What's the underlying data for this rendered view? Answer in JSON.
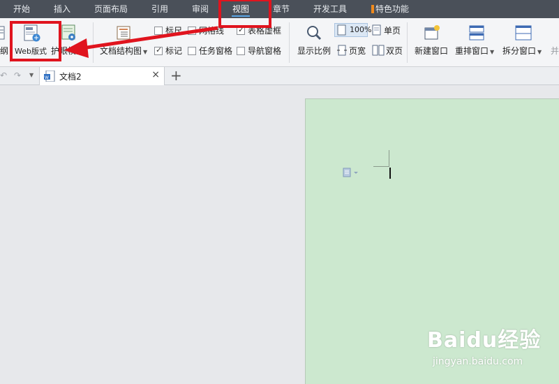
{
  "menubar": {
    "items": [
      "开始",
      "插入",
      "页面布局",
      "引用",
      "审阅",
      "视图",
      "章节",
      "开发工具",
      "特色功能"
    ],
    "active": "视图"
  },
  "ribbon": {
    "outline_label": "纲",
    "web_layout_label": "Web版式",
    "protect_mode_label": "护眼模式",
    "doc_structure_label": "文档结构图",
    "ruler_label": "标尺",
    "gridlines_label": "网格线",
    "table_frame_label": "表格虚框",
    "mark_label": "标记",
    "task_pane_label": "任务窗格",
    "nav_pane_label": "导航窗格",
    "zoom_label": "显示比例",
    "zoom_100_label": "100%",
    "single_page_label": "单页",
    "page_width_label": "页宽",
    "double_page_label": "双页",
    "new_window_label": "新建窗口",
    "arrange_window_label": "重排窗口",
    "split_window_label": "拆分窗口",
    "more_label": "并"
  },
  "tabbar": {
    "doc_tab_label": "文档2",
    "new_tab_symbol": "+",
    "close_symbol": "×"
  },
  "watermark": {
    "brand": "Baidu经验",
    "url": "jingyan.baidu.com"
  },
  "colors": {
    "menubar_bg": "#4a5059",
    "page_bg": "#cce8cf",
    "annotation_red": "#e0141e",
    "active_underline": "#5aa6e6"
  }
}
